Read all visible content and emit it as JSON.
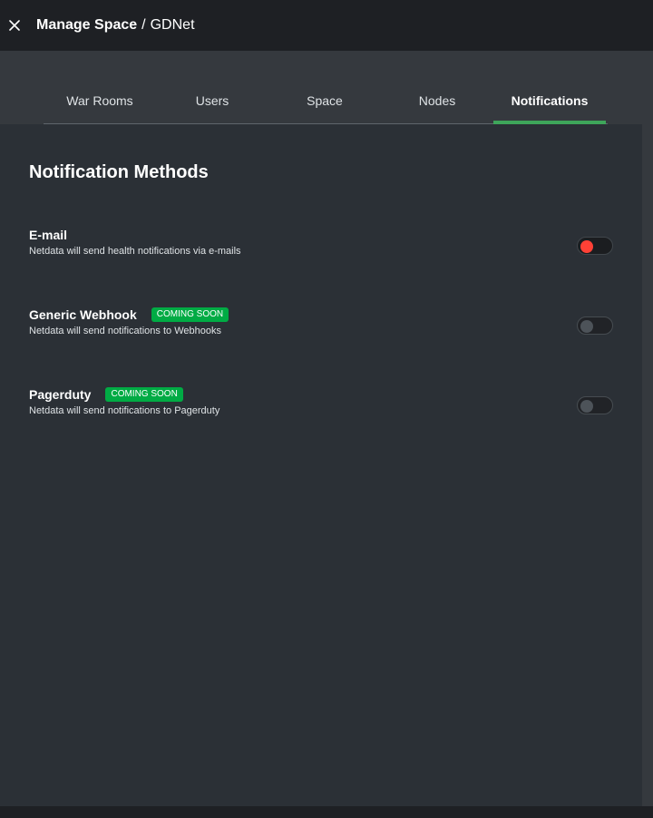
{
  "header": {
    "title_strong": "Manage Space",
    "separator": "/",
    "space_name": "GDNet",
    "close_icon": "close-icon"
  },
  "tabs": [
    {
      "label": "War Rooms",
      "active": false
    },
    {
      "label": "Users",
      "active": false
    },
    {
      "label": "Space",
      "active": false
    },
    {
      "label": "Nodes",
      "active": false
    },
    {
      "label": "Notifications",
      "active": true
    }
  ],
  "content": {
    "section_title": "Notification Methods",
    "methods": [
      {
        "name": "E-mail",
        "badge": "",
        "description": "Netdata will send health notifications via e-mails",
        "toggle_state": "off-error"
      },
      {
        "name": "Generic Webhook",
        "badge": "COMING SOON",
        "description": "Netdata will send notifications to Webhooks",
        "toggle_state": "off-disabled"
      },
      {
        "name": "Pagerduty",
        "badge": "COMING SOON",
        "description": "Netdata will send notifications to Pagerduty",
        "toggle_state": "off-disabled"
      }
    ]
  },
  "colors": {
    "header_bg": "#1e2024",
    "tabbar_bg": "#35393e",
    "content_bg": "#2b3036",
    "accent_green": "#3ea55a",
    "badge_green": "#00ab44",
    "toggle_error": "#ff4136"
  }
}
